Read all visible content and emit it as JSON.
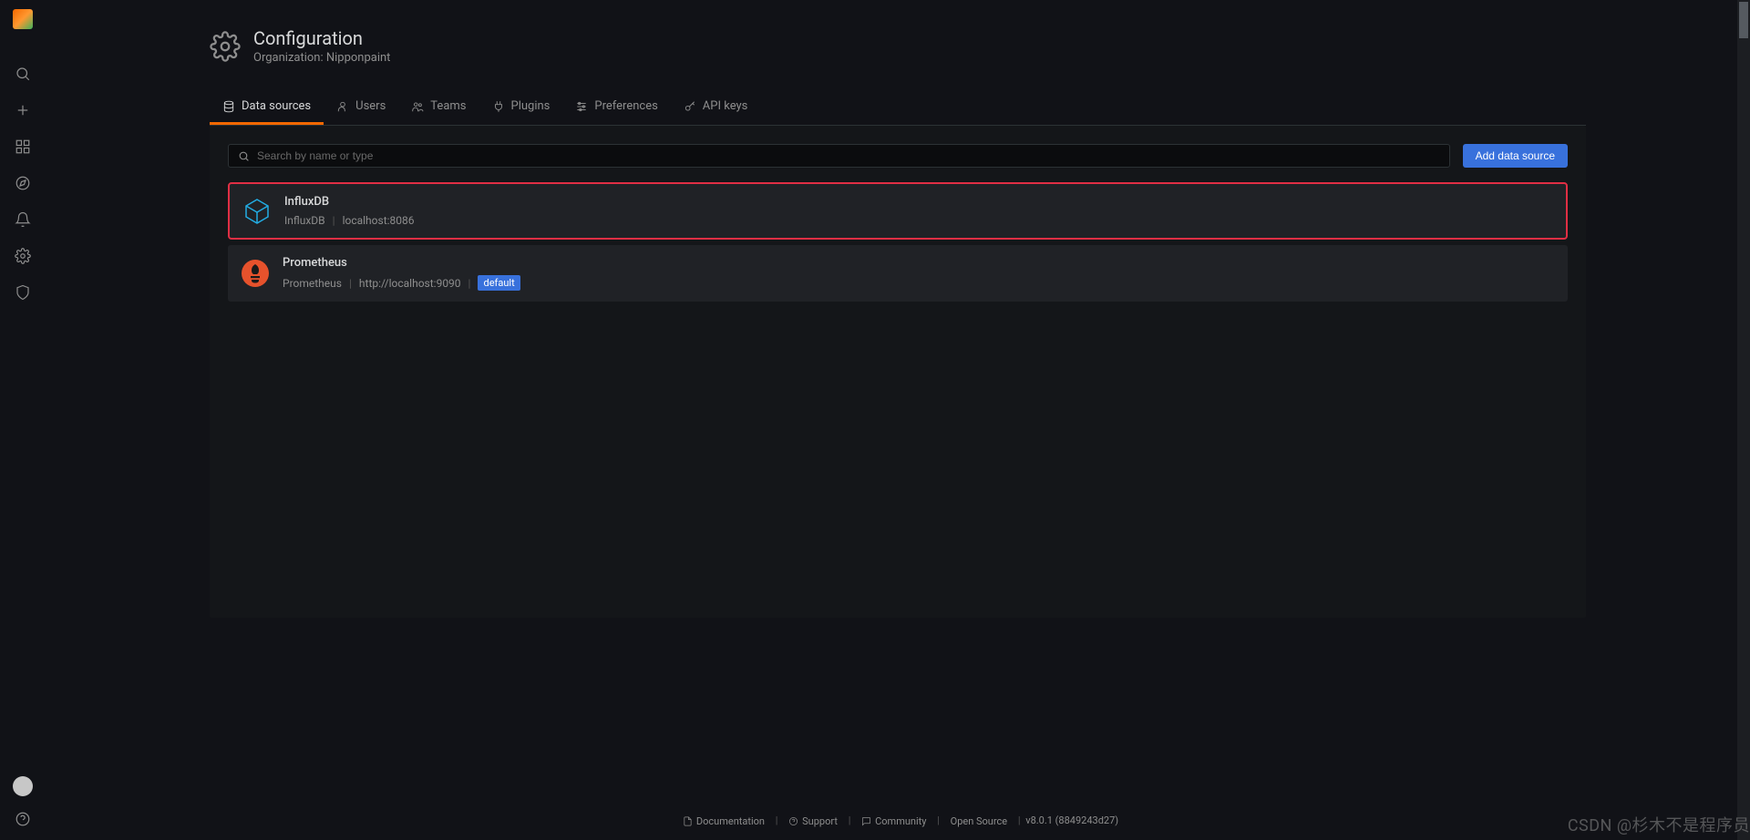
{
  "page": {
    "title": "Configuration",
    "subtitle": "Organization: Nipponpaint"
  },
  "tabs": [
    {
      "label": "Data sources"
    },
    {
      "label": "Users"
    },
    {
      "label": "Teams"
    },
    {
      "label": "Plugins"
    },
    {
      "label": "Preferences"
    },
    {
      "label": "API keys"
    }
  ],
  "search": {
    "placeholder": "Search by name or type"
  },
  "toolbar": {
    "add_button": "Add data source"
  },
  "datasources": [
    {
      "name": "InfluxDB",
      "type": "InfluxDB",
      "url": "localhost:8086",
      "highlighted": true,
      "default": false
    },
    {
      "name": "Prometheus",
      "type": "Prometheus",
      "url": "http://localhost:9090",
      "highlighted": false,
      "default": true
    }
  ],
  "badge": {
    "default": "default"
  },
  "footer": {
    "links": [
      {
        "label": "Documentation"
      },
      {
        "label": "Support"
      },
      {
        "label": "Community"
      },
      {
        "label": "Open Source"
      }
    ],
    "version": "v8.0.1 (8849243d27)"
  },
  "watermark": "CSDN @杉木不是程序员"
}
